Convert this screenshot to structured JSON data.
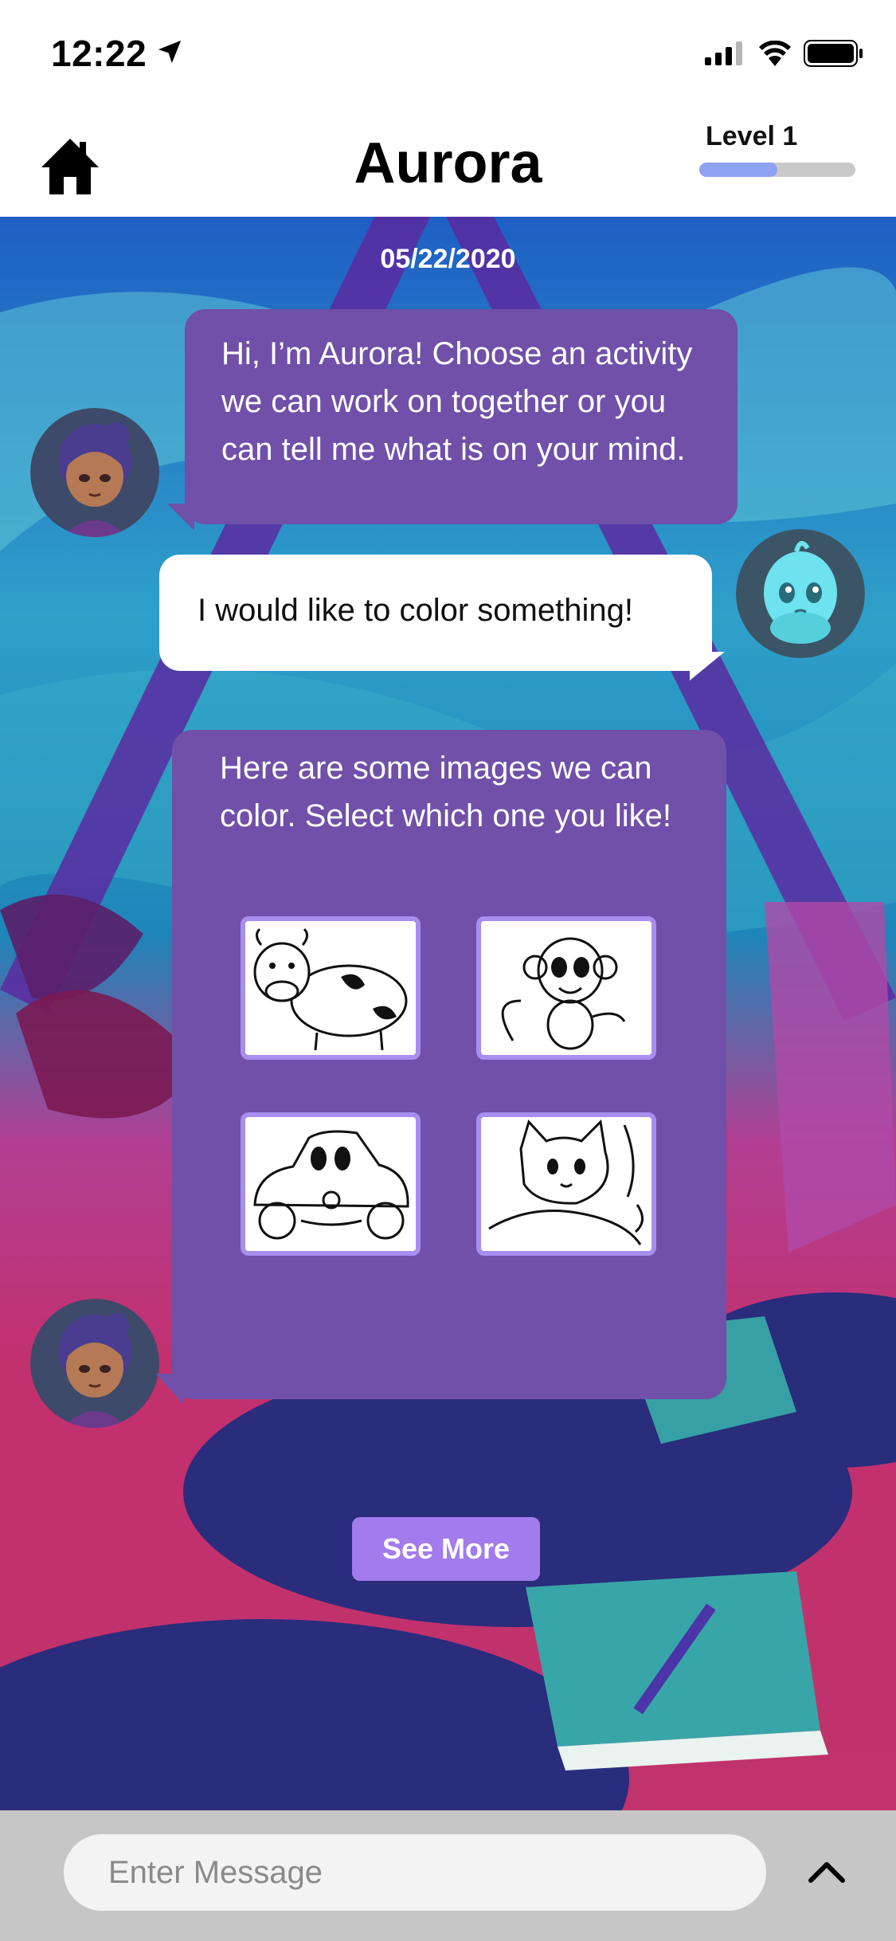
{
  "status_bar": {
    "time": "12:22"
  },
  "header": {
    "title": "Aurora",
    "level_label": "Level 1",
    "level_progress": 0.5
  },
  "chat": {
    "date": "05/22/2020",
    "messages": [
      {
        "from": "bot",
        "text": "Hi, I’m Aurora! Choose an activity we can work on together or you can tell me what is on your mind."
      },
      {
        "from": "user",
        "text": "I would like to color something!"
      },
      {
        "from": "bot",
        "text": "Here are some images we can color.  Select which one you like!"
      }
    ],
    "coloring_images": [
      "cow-drawing",
      "monkey-drawing",
      "car-drawing",
      "cat-drawing"
    ],
    "see_more_label": "See More"
  },
  "composer": {
    "placeholder": "Enter Message"
  },
  "colors": {
    "bot_bubble": "#7050a8",
    "user_bubble": "#ffffff",
    "accent": "#a27cec",
    "progress": "#8ea2f2"
  }
}
